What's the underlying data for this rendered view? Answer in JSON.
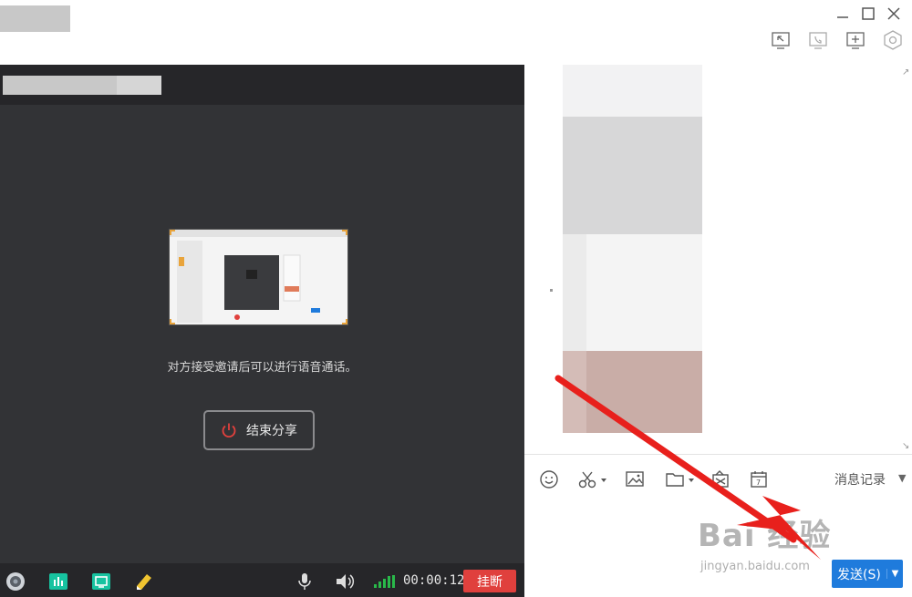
{
  "window": {
    "minimize_icon": "minimize-icon",
    "maximize_icon": "maximize-icon",
    "close_icon": "close-icon"
  },
  "toolbar_top": {
    "icons": [
      "exit-fullscreen-icon",
      "voice-call-icon",
      "add-window-icon",
      "settings-hex-icon"
    ]
  },
  "share": {
    "hint": "对方接受邀请后可以进行语音通话。",
    "end_share_label": "结束分享",
    "timer": "00:00:12",
    "hangup_label": "挂断"
  },
  "chat": {
    "history_label": "消息记录",
    "send_label": "发送(S)",
    "send_caret": "▼",
    "history_caret": "▼"
  },
  "watermark": {
    "main": "Bai 经验",
    "sub": "jingyan.baidu.com"
  },
  "colors": {
    "panel_dark": "#323336",
    "header_dark": "#262629",
    "hangup_red": "#e0403d",
    "send_blue": "#1f7bdc",
    "arrow_red": "#e8201c"
  }
}
